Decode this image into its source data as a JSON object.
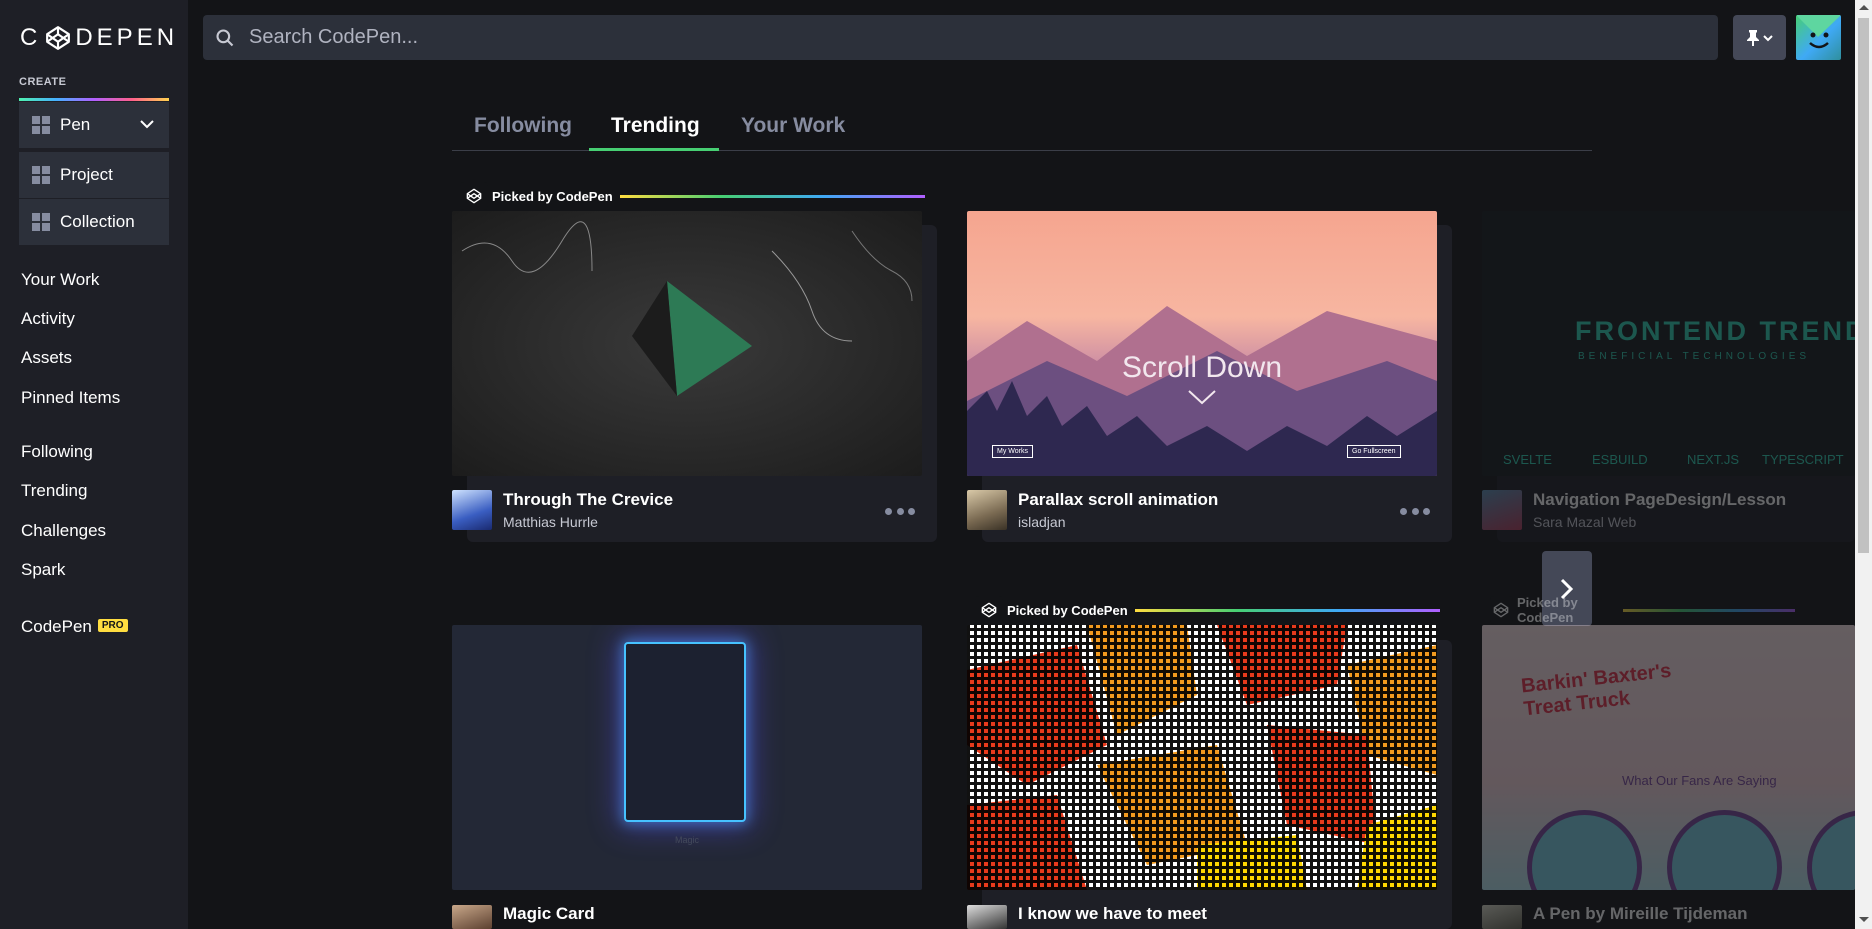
{
  "logo": {
    "text": "CODEPEN"
  },
  "sidebar": {
    "create_label": "CREATE",
    "create_buttons": [
      {
        "label": "Pen"
      },
      {
        "label": "Project"
      },
      {
        "label": "Collection"
      }
    ],
    "nav_group_1": [
      "Your Work",
      "Activity",
      "Assets",
      "Pinned Items"
    ],
    "nav_group_2": [
      "Following",
      "Trending",
      "Challenges",
      "Spark"
    ],
    "codepen_pro": {
      "label": "CodePen",
      "badge": "PRO"
    }
  },
  "header": {
    "search_placeholder": "Search CodePen..."
  },
  "tabs": [
    {
      "label": "Following",
      "active": false
    },
    {
      "label": "Trending",
      "active": true
    },
    {
      "label": "Your Work",
      "active": false
    }
  ],
  "picked_label": "Picked by CodePen",
  "cards": [
    {
      "title": "Through The Crevice",
      "author": "Matthias Hurrle",
      "picked": true
    },
    {
      "title": "Parallax scroll animation",
      "author": "isladjan",
      "picked": false,
      "thumb_text": "Scroll Down",
      "thumb_btn_left": "My Works",
      "thumb_btn_right": "Go Fullscreen"
    },
    {
      "title": "Navigation PageDesign/Lesson",
      "author": "Sara Mazal Web",
      "picked": false,
      "thumb_text": "FRONTEND TRENDS",
      "thumb_subtext": "BENEFICIAL TECHNOLOGIES",
      "thumb_tags": [
        "SVELTE",
        "ESBUILD",
        "NEXT.JS",
        "TYPESCRIPT"
      ]
    },
    {
      "title": "Magic Card",
      "author": "",
      "picked": false,
      "thumb_text": "Magic"
    },
    {
      "title": "I know we have to meet",
      "author": "",
      "picked": true
    },
    {
      "title": "A Pen by Mireille Tijdeman",
      "author": "",
      "picked": true,
      "thumb_text": "Barkin' Baxter's Treat Truck",
      "thumb_subtext": "What Our Fans Are Saying"
    }
  ],
  "colors": {
    "background": "#131417",
    "sidebar": "#1e1f26",
    "accent_green": "#47cf73",
    "pro_yellow": "#ffdd40"
  }
}
